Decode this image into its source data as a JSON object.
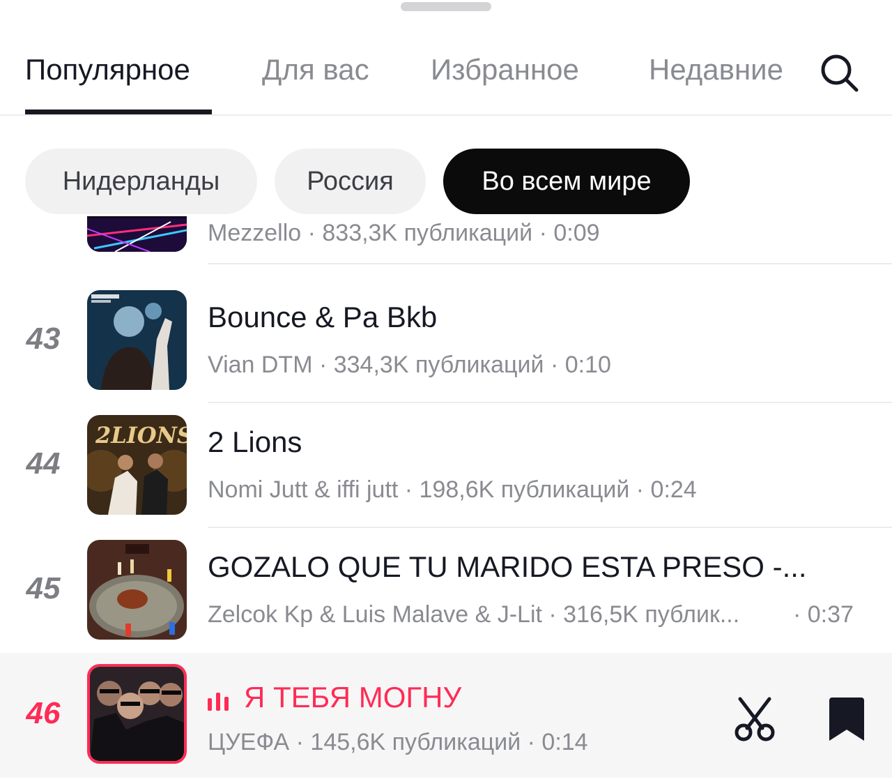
{
  "tabs": [
    {
      "label": "Популярное"
    },
    {
      "label": "Для вас"
    },
    {
      "label": "Избранное"
    },
    {
      "label": "Недавние"
    }
  ],
  "filters": [
    {
      "label": "Нидерланды"
    },
    {
      "label": "Россия"
    },
    {
      "label": "Во всем мире",
      "selected": true
    }
  ],
  "tracks": [
    {
      "meta": "Mezzello · 833,3K публикаций · 0:09"
    },
    {
      "rank": "43",
      "title": "Bounce & Pa Bkb",
      "meta": "Vian DTM · 334,3K публикаций · 0:10"
    },
    {
      "rank": "44",
      "title": "2 Lions",
      "meta": "Nomi Jutt & iffi jutt · 198,6K публикаций · 0:24",
      "cover_text": "2LIONS"
    },
    {
      "rank": "45",
      "title": "GOZALO QUE TU MARIDO ESTA PRESO -...",
      "meta": "Zelcok Kp & Luis Malave & J-Lit · 316,5K публик...",
      "duration": "· 0:37"
    },
    {
      "rank": "46",
      "title": "Я ТЕБЯ МОГНУ",
      "meta": "ЦУЕФА · 145,6K публикаций · 0:14",
      "playing": true
    }
  ],
  "icons": {
    "search": "search-icon",
    "clip": "scissors-icon",
    "save": "bookmark-icon",
    "playing": "equalizer-icon"
  },
  "colors": {
    "accent": "#fe2c55",
    "text": "#161823",
    "secondary": "#8a8b91",
    "chip_selected": "#0b0b0c"
  }
}
